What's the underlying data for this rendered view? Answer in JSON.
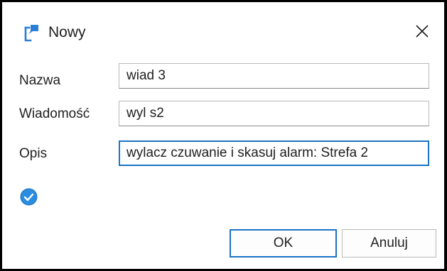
{
  "window": {
    "title": "Nowy",
    "icon": "app-window-icon",
    "close_icon": "close-icon"
  },
  "form": {
    "name_label": "Nazwa",
    "name_value": "wiad 3",
    "message_label": "Wiadomość",
    "message_value": "wyl s2",
    "description_label": "Opis",
    "description_value": "wylacz czuwanie i skasuj alarm: Strefa 2",
    "status_icon": "check-circle-icon"
  },
  "buttons": {
    "ok_label": "OK",
    "cancel_label": "Anuluj"
  },
  "colors": {
    "accent": "#1a73c8",
    "status_check": "#2b8de0"
  }
}
